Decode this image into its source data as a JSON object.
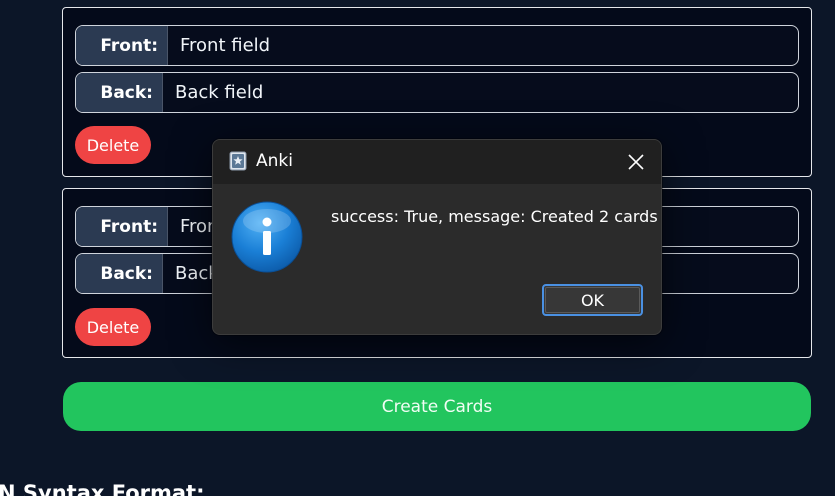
{
  "cards": [
    {
      "front_label": "Front:",
      "front_value": "Front field",
      "back_label": "Back:",
      "back_value": "Back field",
      "delete_label": "Delete"
    },
    {
      "front_label": "Front:",
      "front_value": "Fron",
      "back_label": "Back:",
      "back_value": "Back",
      "delete_label": "Delete"
    }
  ],
  "create_button_label": "Create Cards",
  "partial_heading": "N Syntax Format:",
  "dialog": {
    "title": "Anki",
    "message": "success: True, message: Created 2 cards",
    "ok_label": "OK",
    "icon": "info-icon"
  },
  "colors": {
    "background": "#0c1628",
    "delete": "#ef4444",
    "create": "#22c55e",
    "dialog_bg": "#2b2b2b",
    "accent": "#4a90e2"
  }
}
